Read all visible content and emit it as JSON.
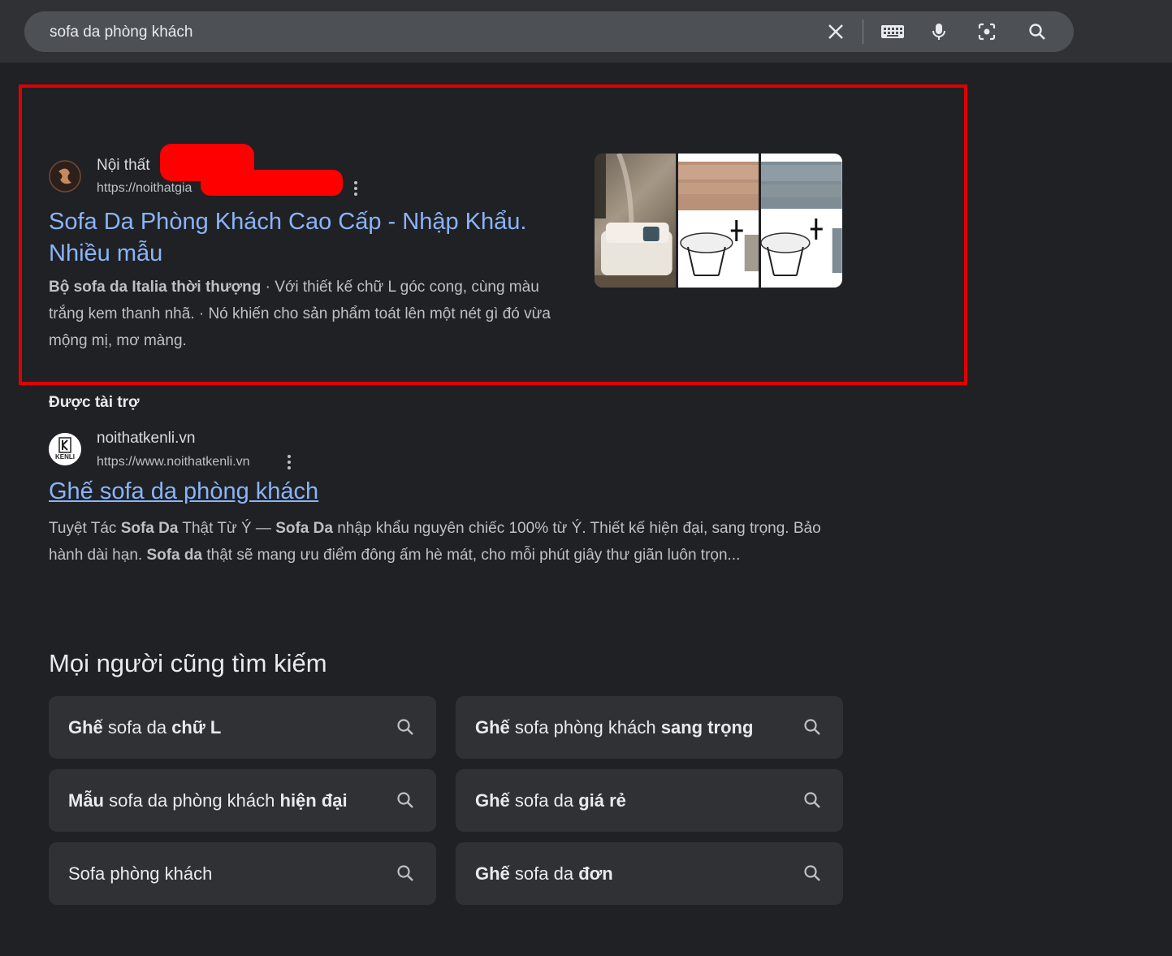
{
  "search": {
    "query": "sofa da phòng khách"
  },
  "colors": {
    "background": "#202124",
    "link": "#8ab4f8",
    "highlight_border": "#e00000"
  },
  "result1": {
    "site_name": "Nội thất",
    "url": "https://noithatgia",
    "title": "Sofa Da Phòng Khách Cao Cấp - Nhập Khẩu. Nhiều mẫu",
    "snippet": [
      {
        "text": "Bộ sofa da Italia thời thượng",
        "bold": true
      },
      {
        "text": " · Với thiết kế chữ L góc cong, cùng màu trắng kem thanh nhã. · Nó khiến cho sản phẩm toát lên một nét gì đó vừa mộng mị, mơ màng.",
        "bold": false
      }
    ]
  },
  "ad": {
    "label": "Được tài trợ",
    "site_name": "noithatkenli.vn",
    "url": "https://www.noithatkenli.vn",
    "logo_text": "KENLI",
    "title": "Ghế sofa da phòng khách",
    "snippet": [
      {
        "text": "Tuyệt Tác ",
        "bold": false
      },
      {
        "text": "Sofa Da",
        "bold": true
      },
      {
        "text": " Thật Từ Ý — ",
        "bold": false
      },
      {
        "text": "Sofa Da",
        "bold": true
      },
      {
        "text": " nhập khẩu nguyên chiếc 100% từ Ý. Thiết kế hiện đại, sang trọng. Bảo hành dài hạn. ",
        "bold": false
      },
      {
        "text": "Sofa da",
        "bold": true
      },
      {
        "text": " thật sẽ mang ưu điểm đông ấm hè mát, cho mỗi phút giây thư giãn luôn trọn...",
        "bold": false
      }
    ]
  },
  "related": {
    "heading": "Mọi người cũng tìm kiếm",
    "chips": [
      [
        {
          "text": "Ghế",
          "bold": true
        },
        {
          "text": " sofa da ",
          "bold": false
        },
        {
          "text": "chữ L",
          "bold": true
        }
      ],
      [
        {
          "text": "Ghế",
          "bold": true
        },
        {
          "text": " sofa phòng khách ",
          "bold": false
        },
        {
          "text": "sang trọng",
          "bold": true
        }
      ],
      [
        {
          "text": "Mẫu",
          "bold": true
        },
        {
          "text": " sofa da phòng khách ",
          "bold": false
        },
        {
          "text": "hiện đại",
          "bold": true
        }
      ],
      [
        {
          "text": "Ghế",
          "bold": true
        },
        {
          "text": " sofa da ",
          "bold": false
        },
        {
          "text": "giá rẻ",
          "bold": true
        }
      ],
      [
        {
          "text": "Sofa phòng khách",
          "bold": false
        }
      ],
      [
        {
          "text": "Ghế",
          "bold": true
        },
        {
          "text": " sofa da ",
          "bold": false
        },
        {
          "text": "đơn",
          "bold": true
        }
      ]
    ]
  }
}
